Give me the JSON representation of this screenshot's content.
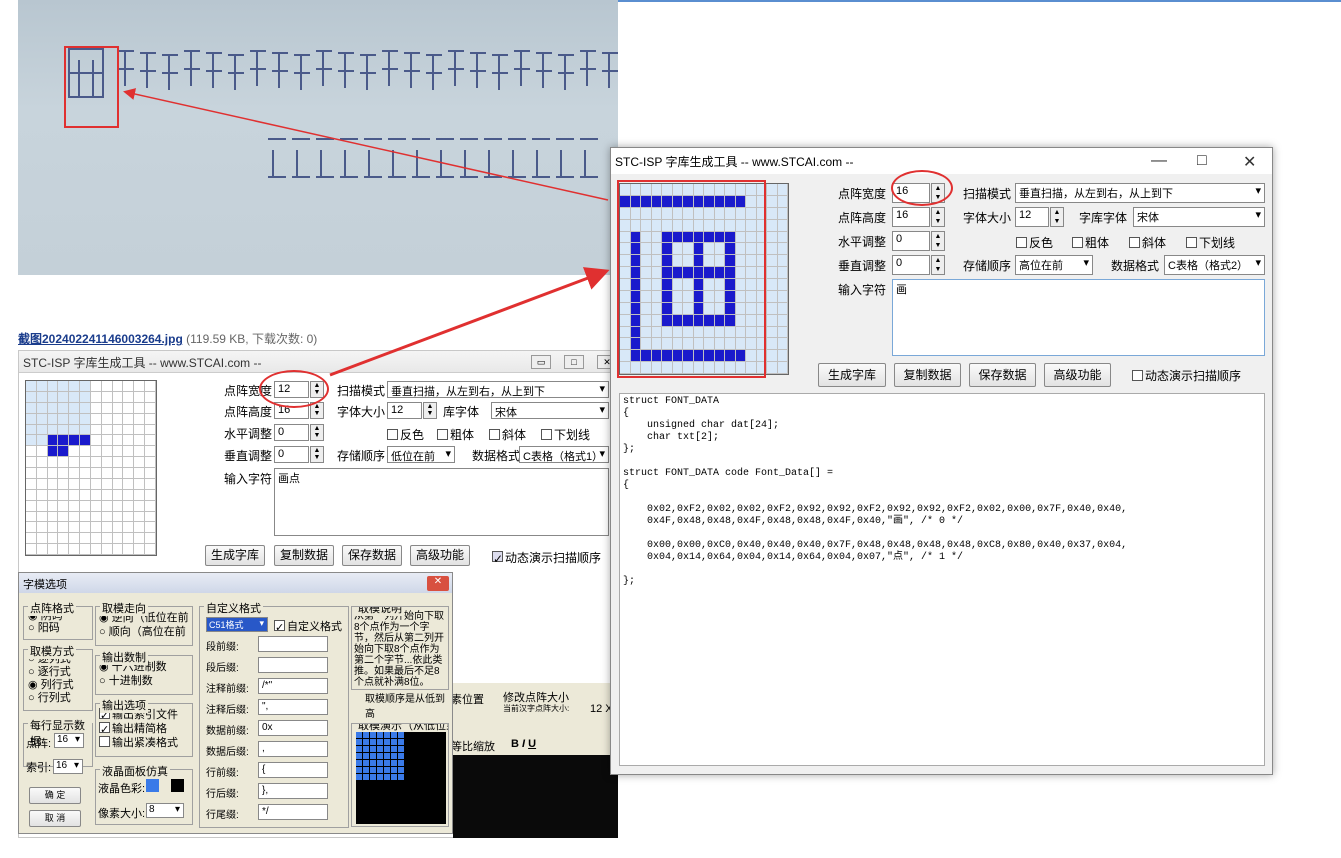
{
  "photo": {
    "caption_link": "截图202402241146003264.jpg",
    "caption_meta": "(119.59 KB, 下载次数: 0)"
  },
  "old_window": {
    "title": "STC-ISP 字库生成工具 -- www.STCAI.com --",
    "labels": {
      "dot_width": "点阵宽度",
      "dot_height": "点阵高度",
      "h_adjust": "水平调整",
      "v_adjust": "垂直调整",
      "input_char": "输入字符",
      "scan_mode": "扫描模式",
      "font_size": "字体大小",
      "font_lib": "库字体",
      "store_order": "存储顺序",
      "data_format": "数据格式"
    },
    "values": {
      "dot_width": "12",
      "dot_height": "16",
      "h_adjust": "0",
      "v_adjust": "0",
      "font_size": "12",
      "scan_mode": "垂直扫描，从左到右，从上到下",
      "font": "宋体",
      "store_order": "低位在前",
      "data_format": "C表格（格式1）",
      "input_char": "画点"
    },
    "checks": {
      "invert": "反色",
      "bold": "粗体",
      "italic": "斜体",
      "underline": "下划线"
    },
    "buttons": {
      "gen": "生成字库",
      "copy": "复制数据",
      "save": "保存数据",
      "advanced": "高级功能"
    },
    "demo_check": "动态演示扫描顺序"
  },
  "options_dialog": {
    "title": "字模选项",
    "dot_format": {
      "title": "点阵格式",
      "a": "阴码",
      "b": "阳码"
    },
    "direction": {
      "title": "取模走向",
      "a": "逆向（低位在前",
      "b": "顺向（高位在前"
    },
    "mode": {
      "title": "取模方式",
      "a": "逐列式",
      "b": "逐行式",
      "c": "列行式",
      "d": "行列式"
    },
    "numeral": {
      "title": "输出数制",
      "a": "十六进制数",
      "b": "十进制数"
    },
    "output": {
      "title": "输出选项",
      "a": "输出索引文件",
      "b": "输出精简格",
      "c": "输出紧凑格式"
    },
    "per_line": {
      "title": "每行显示数据",
      "dot_label": "点阵:",
      "dot_val": "16",
      "idx_label": "索引:",
      "idx_val": "16"
    },
    "lcd": {
      "title": "液晶面板仿真",
      "color": "液晶色彩:",
      "pixel": "像素大小:",
      "pixel_val": "8"
    },
    "ok": "确 定",
    "cancel": "取 消",
    "custom": {
      "title": "自定义格式",
      "fmt": "C51格式",
      "chk": "自定义格式",
      "rows": [
        {
          "k": "段前缀:",
          "v": ""
        },
        {
          "k": "段后缀:",
          "v": ""
        },
        {
          "k": "注释前缀:",
          "v": "/*\""
        },
        {
          "k": "注释后缀:",
          "v": "\","
        },
        {
          "k": "数据前缀:",
          "v": "0x"
        },
        {
          "k": "数据后缀:",
          "v": ","
        },
        {
          "k": "行前缀:",
          "v": "{"
        },
        {
          "k": "行后缀:",
          "v": "},"
        },
        {
          "k": "行尾缀:",
          "v": "*/"
        }
      ]
    },
    "desc": {
      "title": "取模说明",
      "text": "从第一列开始向下取8个点作为一个字节，然后从第二列开始向下取8个点作为第二个字节...依此类推。如果最后不足8个点就补满8位。",
      "order": "取模顺序是从低到高",
      "demo_title": "取模演示（从低位到"
    }
  },
  "behind": {
    "pos_label": "素位置",
    "modify": "修改点阵大小",
    "size_label": "当前汉字点阵大小:",
    "size_val": "12 X",
    "scale": "等比缩放"
  },
  "new_window": {
    "title": "STC-ISP 字库生成工具 -- www.STCAI.com --",
    "labels": {
      "dot_width": "点阵宽度",
      "dot_height": "点阵高度",
      "h_adjust": "水平调整",
      "v_adjust": "垂直调整",
      "input_char": "输入字符",
      "scan_mode": "扫描模式",
      "font_size": "字体大小",
      "font_lib": "字库字体",
      "store_order": "存储顺序",
      "data_format": "数据格式"
    },
    "values": {
      "dot_width": "16",
      "dot_height": "16",
      "h_adjust": "0",
      "v_adjust": "0",
      "font_size": "12",
      "scan_mode": "垂直扫描，从左到右，从上到下",
      "font": "宋体",
      "store_order": "高位在前",
      "data_format": "C表格（格式2）",
      "input_char": "画"
    },
    "checks": {
      "invert": "反色",
      "bold": "粗体",
      "italic": "斜体",
      "underline": "下划线"
    },
    "buttons": {
      "gen": "生成字库",
      "copy": "复制数据",
      "save": "保存数据",
      "advanced": "高级功能"
    },
    "demo_check": "动态演示扫描顺序",
    "code": "struct FONT_DATA\n{\n    unsigned char dat[24];\n    char txt[2];\n};\n\nstruct FONT_DATA code Font_Data[] =\n{\n\n    0x02,0xF2,0x02,0x02,0xF2,0x92,0x92,0xF2,0x92,0x92,0xF2,0x02,0x00,0x7F,0x40,0x40,\n    0x4F,0x48,0x48,0x4F,0x48,0x48,0x4F,0x40,\"画\", /* 0 */\n\n    0x00,0x00,0xC0,0x40,0x40,0x40,0x7F,0x48,0x48,0x48,0x48,0xC8,0x80,0x40,0x37,0x04,\n    0x04,0x14,0x64,0x04,0x14,0x64,0x04,0x07,\"点\", /* 1 */\n\n};"
  },
  "colors": {
    "blue": "#1a1acc",
    "light": "#d8e8f8",
    "red": "#e03030"
  }
}
